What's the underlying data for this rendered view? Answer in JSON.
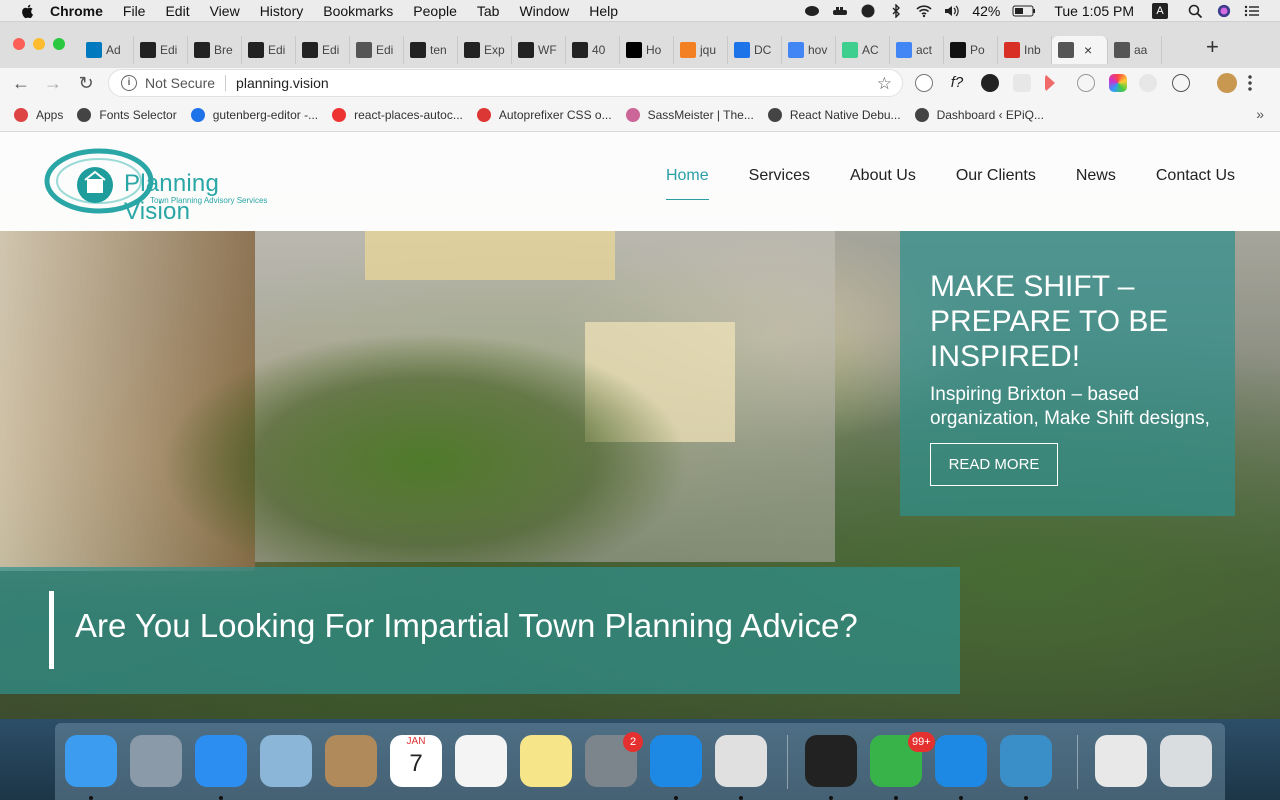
{
  "menubar": {
    "app": "Chrome",
    "items": [
      "File",
      "Edit",
      "View",
      "History",
      "Bookmarks",
      "People",
      "Tab",
      "Window",
      "Help"
    ],
    "battery": "42%",
    "clock": "Tue 1:05 PM",
    "user_initial": "A"
  },
  "tabs": [
    {
      "label": "Ad",
      "icon": "trello-icon",
      "color": "#0079bf"
    },
    {
      "label": "Edi",
      "icon": "b-icon",
      "color": "#222"
    },
    {
      "label": "Bre",
      "icon": "b-icon",
      "color": "#222"
    },
    {
      "label": "Edi",
      "icon": "b-icon",
      "color": "#222"
    },
    {
      "label": "Edi",
      "icon": "b-icon",
      "color": "#222"
    },
    {
      "label": "Edi",
      "icon": "globe-icon",
      "color": "#555"
    },
    {
      "label": "ten",
      "icon": "b-icon",
      "color": "#222"
    },
    {
      "label": "Exp",
      "icon": "b-icon",
      "color": "#222"
    },
    {
      "label": "WF",
      "icon": "b-icon",
      "color": "#222"
    },
    {
      "label": "40",
      "icon": "b-icon",
      "color": "#222"
    },
    {
      "label": "Ho",
      "icon": "medium-icon",
      "color": "#000"
    },
    {
      "label": "jqu",
      "icon": "stackoverflow-icon",
      "color": "#f48024"
    },
    {
      "label": "DC",
      "icon": "shield-icon",
      "color": "#1e73e8"
    },
    {
      "label": "hov",
      "icon": "google-icon",
      "color": "#4285f4"
    },
    {
      "label": "AC",
      "icon": "a-icon",
      "color": "#3ecf8e"
    },
    {
      "label": "act",
      "icon": "google-icon",
      "color": "#4285f4"
    },
    {
      "label": "Po",
      "icon": "github-icon",
      "color": "#111"
    },
    {
      "label": "Inb",
      "icon": "gmail-icon",
      "color": "#d93025"
    },
    {
      "label": "",
      "icon": "globe-icon",
      "color": "#555",
      "active": true
    },
    {
      "label": "aa",
      "icon": "globe-icon",
      "color": "#555"
    }
  ],
  "toolbar": {
    "security": "Not Secure",
    "url": "planning.vision"
  },
  "bookmarks": [
    {
      "label": "Apps",
      "icon": "apps-grid-icon",
      "color": "#d44"
    },
    {
      "label": "Fonts Selector",
      "icon": "globe-icon",
      "color": "#444"
    },
    {
      "label": "gutenberg-editor -...",
      "icon": "bolt-icon",
      "color": "#1e73e8"
    },
    {
      "label": "react-places-autoc...",
      "icon": "map-pin-icon",
      "color": "#e33"
    },
    {
      "label": "Autoprefixer CSS o...",
      "icon": "autoprefixer-icon",
      "color": "#dd3735"
    },
    {
      "label": "SassMeister | The...",
      "icon": "sass-icon",
      "color": "#c69"
    },
    {
      "label": "React Native Debu...",
      "icon": "globe-icon",
      "color": "#444"
    },
    {
      "label": "Dashboard ‹ EPiQ...",
      "icon": "globe-icon",
      "color": "#444"
    }
  ],
  "site": {
    "logo_name": "Planning Vision",
    "logo_tagline": "Town Planning Advisory Services",
    "nav": [
      {
        "label": "Home",
        "active": true
      },
      {
        "label": "Services"
      },
      {
        "label": "About Us"
      },
      {
        "label": "Our Clients"
      },
      {
        "label": "News"
      },
      {
        "label": "Contact Us"
      }
    ],
    "promo": {
      "heading": "MAKE SHIFT – PREPARE TO BE INSPIRED!",
      "text": "Inspiring Brixton – based organization, Make Shift designs,",
      "button": "READ MORE"
    },
    "question": "Are You Looking For Impartial Town Planning Advice?",
    "accent": "#2a9ea6"
  },
  "dock": [
    {
      "name": "finder-icon",
      "color": "#3b9cf0"
    },
    {
      "name": "launchpad-icon",
      "color": "#8a9aa8"
    },
    {
      "name": "safari-icon",
      "color": "#2c8ef0"
    },
    {
      "name": "mail-icon",
      "color": "#8bb6d8"
    },
    {
      "name": "contacts-icon",
      "color": "#b08a5a"
    },
    {
      "name": "calendar-icon",
      "color": "#ffffff",
      "month": "JAN",
      "day": "7"
    },
    {
      "name": "reminders-icon",
      "color": "#f4f4f4"
    },
    {
      "name": "notes-icon",
      "color": "#f7e58a"
    },
    {
      "name": "system-preferences-icon",
      "color": "#7d858c",
      "badge": "2"
    },
    {
      "name": "vscode-icon",
      "color": "#1e88e5"
    },
    {
      "name": "chrome-icon",
      "color": "#e0e0e0"
    },
    {
      "name": "terminal-icon",
      "color": "#222"
    },
    {
      "name": "upwork-icon",
      "color": "#37b34a",
      "badge": "99+"
    },
    {
      "name": "vscode-insiders-icon",
      "color": "#1e88e5"
    },
    {
      "name": "tableplus-icon",
      "color": "#3a8fc8"
    },
    {
      "name": "xml-document-icon",
      "color": "#e8e8e8"
    },
    {
      "name": "trash-icon",
      "color": "#d9dde0"
    }
  ]
}
